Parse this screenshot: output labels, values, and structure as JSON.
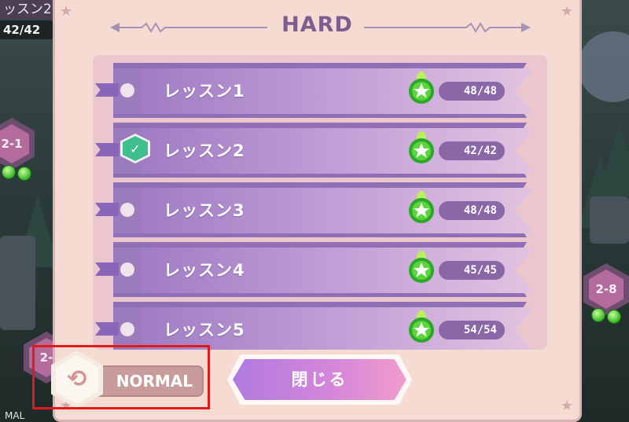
{
  "background": {
    "top_tab_label": "ッスン2",
    "top_count": "42/42",
    "node_left_label": "2-1",
    "node_right_label": "2-8",
    "node_bottom_left_label": "2-",
    "bottom_label": "MAL"
  },
  "dialog": {
    "title": "HARD",
    "lessons": [
      {
        "name": "レッスン1",
        "score": "48/48",
        "cleared": false
      },
      {
        "name": "レッスン2",
        "score": "42/42",
        "cleared": true
      },
      {
        "name": "レッスン3",
        "score": "48/48",
        "cleared": false
      },
      {
        "name": "レッスン4",
        "score": "45/45",
        "cleared": false
      },
      {
        "name": "レッスン5",
        "score": "54/54",
        "cleared": false
      }
    ],
    "normal_button_label": "NORMAL",
    "close_button_label": "閉じる",
    "check_glyph": "✓",
    "swap_glyph": "⟲"
  },
  "colors": {
    "dialog_bg": "#f6dbd3",
    "title": "#7d5c8f",
    "ribbon": "#a07cc4",
    "score_pill": "#8a68a8",
    "check": "#3fbf8d",
    "highlight": "#e01b1b"
  },
  "icons": [
    "star-corner-icon",
    "check-icon",
    "gem-icon",
    "swap-icon"
  ]
}
